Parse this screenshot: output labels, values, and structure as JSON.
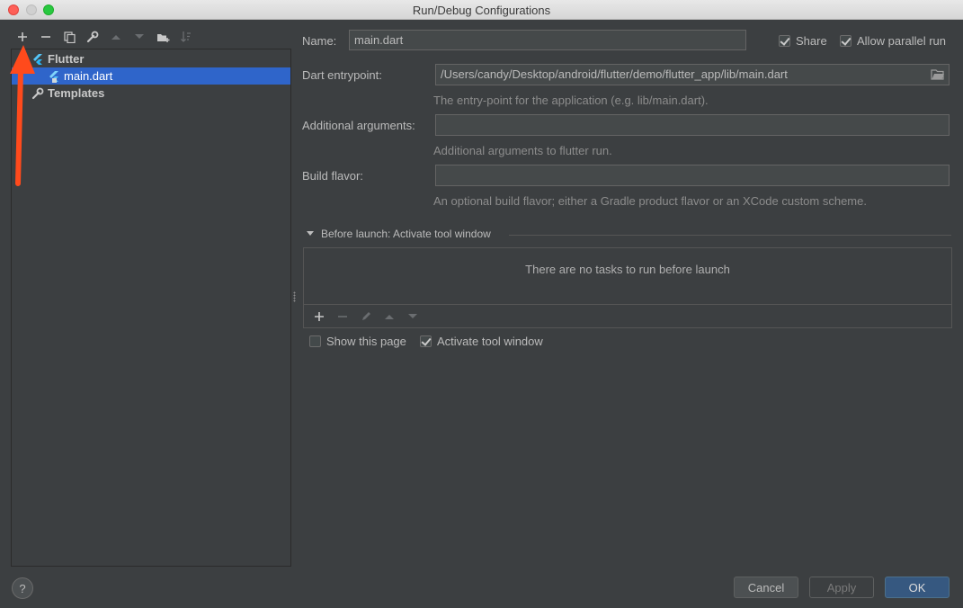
{
  "window": {
    "title": "Run/Debug Configurations"
  },
  "toolbar": {
    "icons": [
      "plus-icon",
      "minus-icon",
      "copy-icon",
      "wrench-icon",
      "arrow-up-icon",
      "arrow-down-icon",
      "folder-add-icon",
      "sort-icon"
    ]
  },
  "tree": {
    "items": [
      {
        "label": "Flutter",
        "icon": "flutter-icon",
        "expanded": true
      },
      {
        "label": "main.dart",
        "icon": "flutter-run-icon",
        "selected": true
      },
      {
        "label": "Templates",
        "icon": "wrench-icon",
        "expanded": false
      }
    ]
  },
  "form": {
    "name_label": "Name:",
    "name_value": "main.dart",
    "share_label": "Share",
    "share_checked": true,
    "parallel_label": "Allow parallel run",
    "parallel_checked": true,
    "entrypoint_label": "Dart entrypoint:",
    "entrypoint_value": "/Users/candy/Desktop/android/flutter/demo/flutter_app/lib/main.dart",
    "entrypoint_hint": "The entry-point for the application (e.g. lib/main.dart).",
    "args_label": "Additional arguments:",
    "args_value": "",
    "args_hint": "Additional arguments to flutter run.",
    "flavor_label": "Build flavor:",
    "flavor_value": "",
    "flavor_hint": "An optional build flavor; either a Gradle product flavor or an XCode custom scheme."
  },
  "before_launch": {
    "title": "Before launch: Activate tool window",
    "empty_text": "There are no tasks to run before launch",
    "show_page_label": "Show this page",
    "show_page_checked": false,
    "activate_label": "Activate tool window",
    "activate_checked": true
  },
  "buttons": {
    "help": "?",
    "cancel": "Cancel",
    "apply": "Apply",
    "ok": "OK"
  },
  "colors": {
    "background": "#3c3f41",
    "selection": "#2f65ca",
    "annotation_arrow": "#ff4a1c",
    "ok_button": "#365880"
  }
}
